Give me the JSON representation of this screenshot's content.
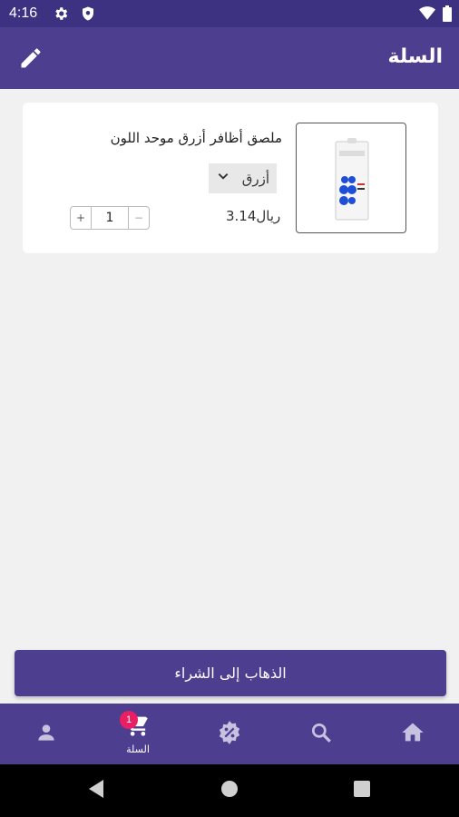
{
  "status_bar": {
    "time": "4:16"
  },
  "app_bar": {
    "title": "السلة"
  },
  "cart": {
    "items": [
      {
        "name": "ملصق أظافر أزرق موحد اللون",
        "variant": "أزرق",
        "price": "3.14ريال",
        "quantity": "1"
      }
    ]
  },
  "checkout": {
    "label": "الذهاب إلى الشراء"
  },
  "bottom_nav": {
    "cart_label": "السلة",
    "cart_badge": "1"
  },
  "colors": {
    "primary": "#4d3e8f",
    "status_bar": "#3d3182",
    "badge": "#e91e63"
  }
}
